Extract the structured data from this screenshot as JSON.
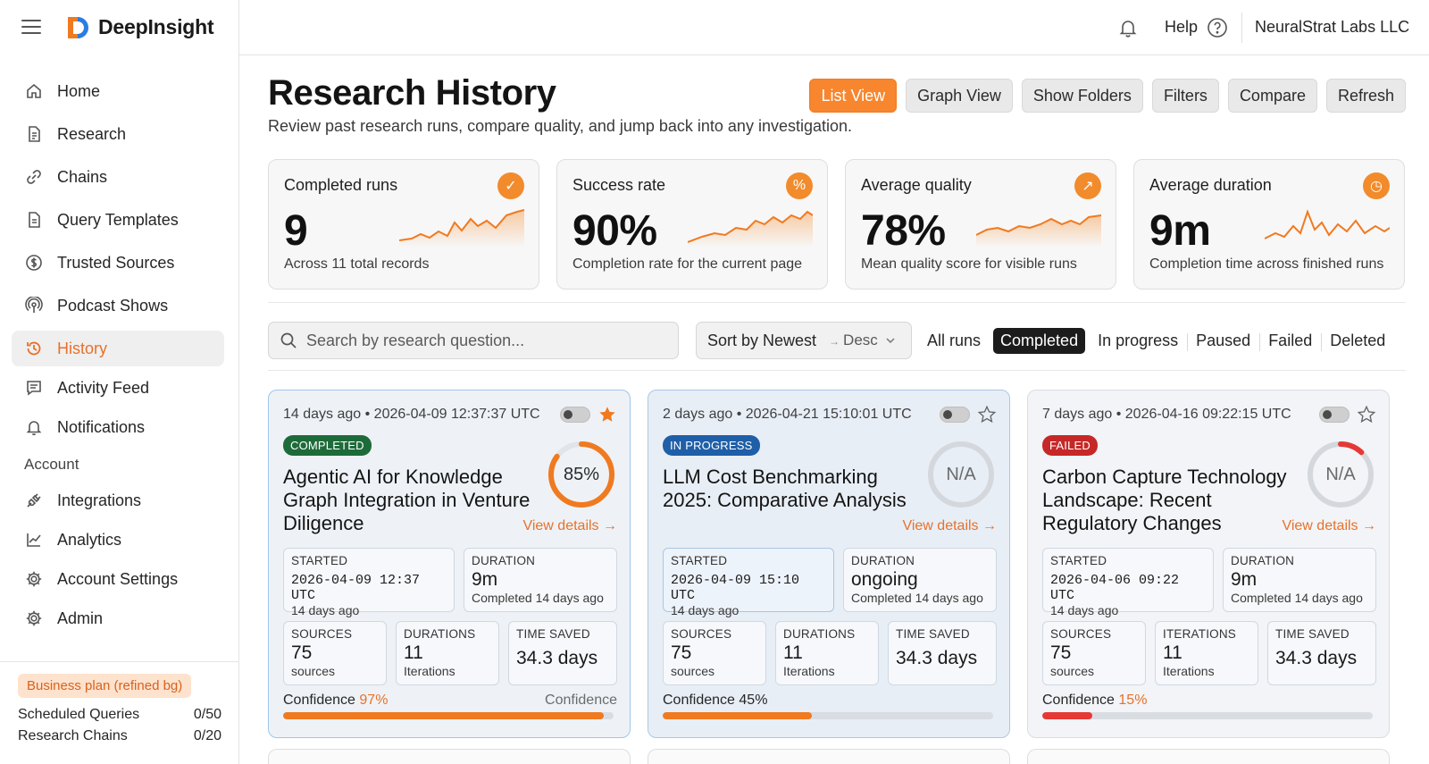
{
  "app": {
    "name": "DeepInsight"
  },
  "sidebar": {
    "items": [
      {
        "label": "Home",
        "icon": "home-icon"
      },
      {
        "label": "Research",
        "icon": "document-icon"
      },
      {
        "label": "Chains",
        "icon": "link-icon"
      },
      {
        "label": "Query Templates",
        "icon": "template-icon"
      },
      {
        "label": "Trusted Sources",
        "icon": "dollar-circle-icon"
      },
      {
        "label": "Podcast Shows",
        "icon": "podcast-icon"
      },
      {
        "label": "History",
        "icon": "history-icon",
        "active": true
      },
      {
        "label": "Activity Feed",
        "icon": "message-icon"
      },
      {
        "label": "Notifications",
        "icon": "bell-icon"
      }
    ],
    "account_label": "Account",
    "account_items": [
      {
        "label": "Integrations",
        "icon": "plug-icon"
      },
      {
        "label": "Analytics",
        "icon": "chart-line-icon"
      },
      {
        "label": "Account Settings",
        "icon": "gear-icon"
      },
      {
        "label": "Admin",
        "icon": "gear-icon"
      }
    ],
    "plan_badge": "Business plan (refined bg)",
    "quotas": [
      {
        "label": "Scheduled Queries",
        "value": "0/50"
      },
      {
        "label": "Research Chains",
        "value": "0/20"
      }
    ]
  },
  "topbar": {
    "help_label": "Help",
    "org_name": "NeuralStrat Labs LLC"
  },
  "page": {
    "title": "Research History",
    "subtitle": "Review past research runs, compare quality, and jump back into any investigation.",
    "view_buttons": [
      "List View",
      "Graph View",
      "Show Folders",
      "Filters",
      "Compare",
      "Refresh"
    ],
    "active_view": "List View"
  },
  "metrics": [
    {
      "label": "Completed runs",
      "value": "9",
      "note": "Across 11 total records",
      "icon_glyph": "✓",
      "icon": "check-circle-icon"
    },
    {
      "label": "Success rate",
      "value": "90%",
      "note": "Completion rate for the current page",
      "icon_glyph": "%",
      "icon": "percent-icon"
    },
    {
      "label": "Average quality",
      "value": "78%",
      "note": "Mean quality score for visible runs",
      "icon_glyph": "↗",
      "icon": "trend-up-icon"
    },
    {
      "label": "Average duration",
      "value": "9m",
      "note": "Completion time across finished runs",
      "icon_glyph": "◷",
      "icon": "clock-icon"
    }
  ],
  "filters": {
    "search_placeholder": "Search by research question...",
    "sort_label": "Sort by Newest",
    "sort_dir": "Desc",
    "status_tabs": [
      "All runs",
      "Completed",
      "In progress",
      "Paused",
      "Failed",
      "Deleted"
    ],
    "active_status": "Completed"
  },
  "runs": [
    {
      "time": "14 days ago • 2026-04-09 12:37:37 UTC",
      "status": "COMPLETED",
      "starred": true,
      "title": "Agentic AI for Knowledge Graph Integration in Venture Diligence",
      "score": "85%",
      "score_fraction": 0.85,
      "ring_color": "#f07a20",
      "view_details": "View details →",
      "started_label": "STARTED",
      "started": "2026-04-09  12:37  UTC",
      "started_ago": "14 days ago",
      "duration_label": "DURATION",
      "duration": "9m",
      "duration_note": "Completed 14 days ago",
      "sources_label": "SOURCES",
      "sources": "75",
      "sources_unit": "sources",
      "iter_label": "DURATIONS",
      "iterations": "11",
      "iter_unit": "Iterations",
      "saved_label": "TIME SAVED",
      "saved": "34.3 days",
      "confidence_label": "Confidence",
      "confidence_pct": "97%",
      "confidence_right": "Confidence",
      "confidence_fraction": 0.97,
      "bar_color": "#f07a20"
    },
    {
      "time": "2 days ago • 2026-04-21 15:10:01 UTC",
      "status": "IN PROGRESS",
      "starred": false,
      "title": "LLM Cost Benchmarking 2025: Comparative Analysis",
      "score": "N/A",
      "score_fraction": 0,
      "ring_color": "#d0d4d8",
      "view_details": "View details →",
      "started_label": "STARTED",
      "started": "2026-04-09  15:10  UTC",
      "started_ago": "14 days ago",
      "duration_label": "DURATION",
      "duration": "ongoing",
      "duration_note": "Completed 14 days ago",
      "sources_label": "SOURCES",
      "sources": "75",
      "sources_unit": "sources",
      "iter_label": "DURATIONS",
      "iterations": "11",
      "iter_unit": "Iterations",
      "saved_label": "TIME SAVED",
      "saved": "34.3 days",
      "confidence_label": "Confidence",
      "confidence_pct": "45%",
      "confidence_right": "",
      "confidence_fraction": 0.45,
      "bar_color": "#f07a20"
    },
    {
      "time": "7 days ago • 2026-04-16 09:22:15 UTC",
      "status": "FAILED",
      "starred": false,
      "title": "Carbon Capture Technology Landscape: Recent Regulatory Changes",
      "score": "N/A",
      "score_fraction": 0.12,
      "ring_color": "#e53935",
      "view_details": "View details →",
      "started_label": "STARTED",
      "started": "2026-04-06  09:22  UTC",
      "started_ago": "14 days ago",
      "duration_label": "DURATION",
      "duration": "9m",
      "duration_note": "Completed 14 days ago",
      "sources_label": "SOURCES",
      "sources": "75",
      "sources_unit": "sources",
      "iter_label": "ITERATIONS",
      "iterations": "11",
      "iter_unit": "Iterations",
      "saved_label": "TIME SAVED",
      "saved": "34.3 days",
      "confidence_label": "Confidence",
      "confidence_pct": "15%",
      "confidence_right": "",
      "confidence_fraction": 0.15,
      "bar_color": "#e53935"
    }
  ],
  "colors": {
    "accent": "#f07a20",
    "success": "#1e6b3a",
    "info": "#1f5fa8",
    "danger": "#c62828"
  }
}
